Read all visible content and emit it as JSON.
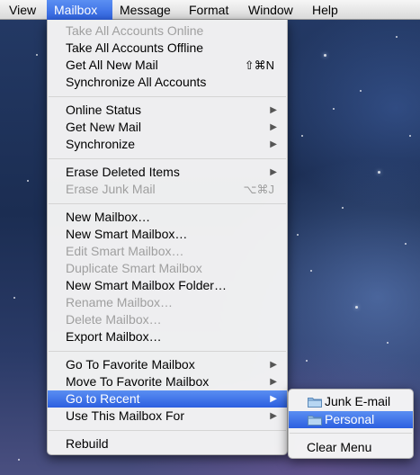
{
  "menubar": {
    "items": [
      {
        "label": "View"
      },
      {
        "label": "Mailbox"
      },
      {
        "label": "Message"
      },
      {
        "label": "Format"
      },
      {
        "label": "Window"
      },
      {
        "label": "Help"
      }
    ],
    "active": "Mailbox"
  },
  "menu": {
    "items": [
      {
        "label": "Take All Accounts Online",
        "enabled": false
      },
      {
        "label": "Take All Accounts Offline",
        "enabled": true
      },
      {
        "label": "Get All New Mail",
        "shortcut": "⇧⌘N",
        "enabled": true
      },
      {
        "label": "Synchronize All Accounts",
        "enabled": true
      },
      {
        "label": "Online Status",
        "submenu": true,
        "enabled": true
      },
      {
        "label": "Get New Mail",
        "submenu": true,
        "enabled": true
      },
      {
        "label": "Synchronize",
        "submenu": true,
        "enabled": true
      },
      {
        "label": "Erase Deleted Items",
        "submenu": true,
        "enabled": true
      },
      {
        "label": "Erase Junk Mail",
        "shortcut": "⌥⌘J",
        "enabled": false
      },
      {
        "label": "New Mailbox…",
        "enabled": true
      },
      {
        "label": "New Smart Mailbox…",
        "enabled": true
      },
      {
        "label": "Edit Smart Mailbox…",
        "enabled": false
      },
      {
        "label": "Duplicate Smart Mailbox",
        "enabled": false
      },
      {
        "label": "New Smart Mailbox Folder…",
        "enabled": true
      },
      {
        "label": "Rename Mailbox…",
        "enabled": false
      },
      {
        "label": "Delete Mailbox…",
        "enabled": false
      },
      {
        "label": "Export Mailbox…",
        "enabled": true
      },
      {
        "label": "Go To Favorite Mailbox",
        "submenu": true,
        "enabled": true
      },
      {
        "label": "Move To Favorite Mailbox",
        "submenu": true,
        "enabled": true
      },
      {
        "label": "Go to Recent",
        "submenu": true,
        "enabled": true,
        "highlighted": true
      },
      {
        "label": "Use This Mailbox For",
        "submenu": true,
        "enabled": true
      },
      {
        "label": "Rebuild",
        "enabled": true
      }
    ]
  },
  "submenu": {
    "items": [
      {
        "label": "Junk E-mail",
        "icon": "folder-icon"
      },
      {
        "label": "Personal",
        "icon": "folder-icon",
        "highlighted": true
      },
      {
        "label": "Clear Menu"
      }
    ]
  },
  "colors": {
    "highlight": "#3a6fe6",
    "disabled_text": "#9f9f9f",
    "folder": "#8fb8e0"
  }
}
